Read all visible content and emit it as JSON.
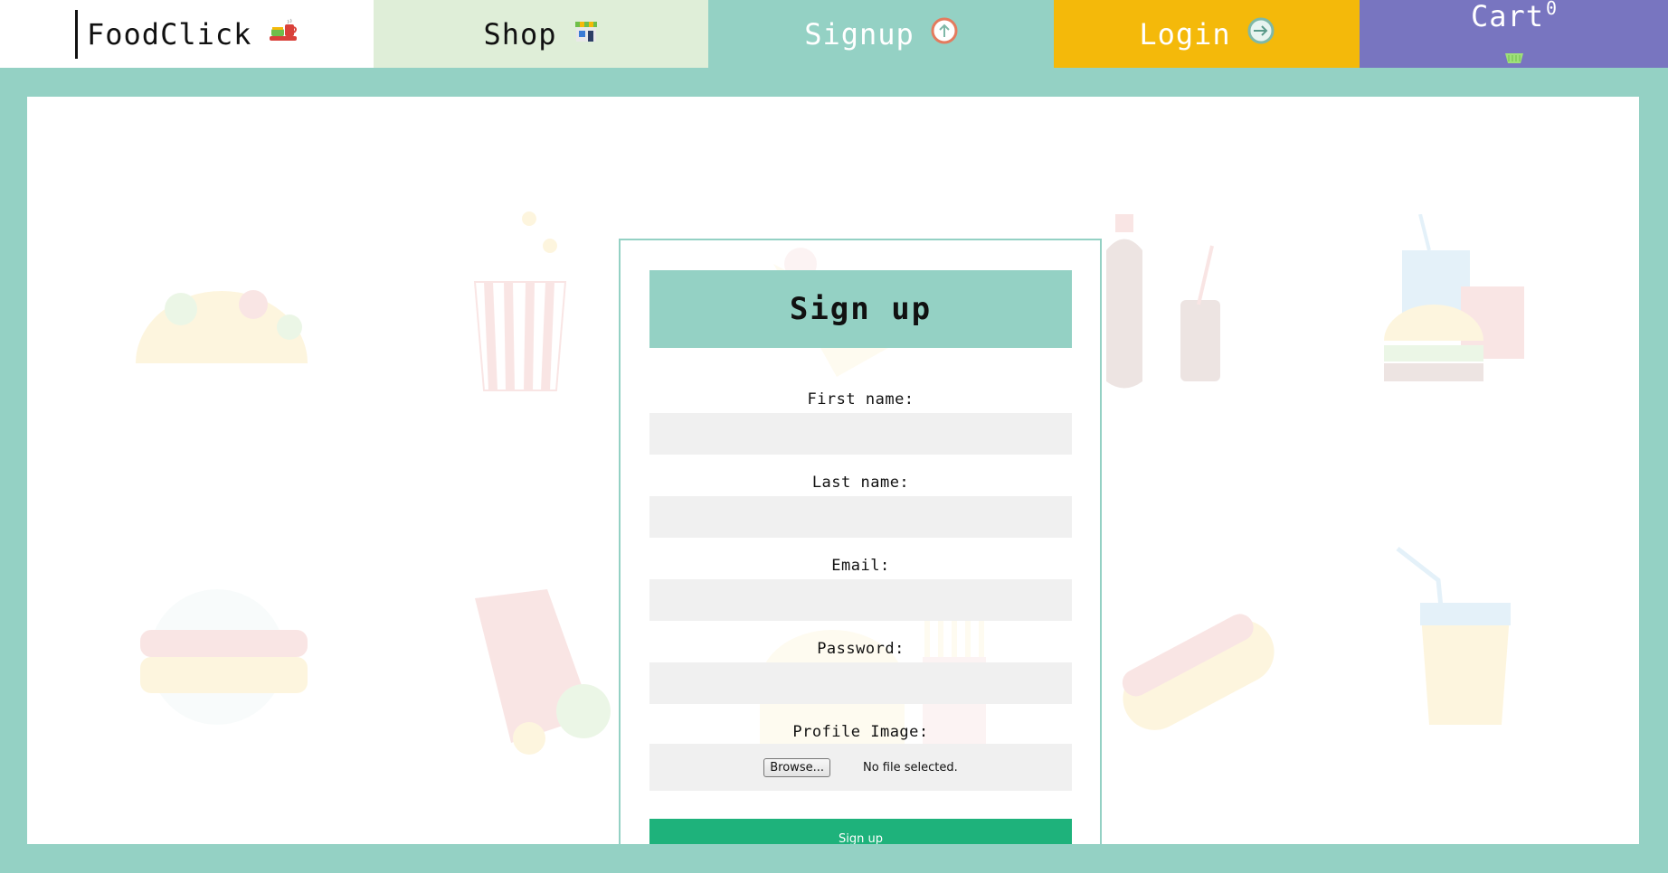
{
  "nav": {
    "brand": {
      "label": "FoodClick",
      "icon": "food-tray-icon"
    },
    "shop": {
      "label": "Shop",
      "icon": "storefront-icon",
      "bg": "#dfeed8"
    },
    "signup": {
      "label": "Signup",
      "icon": "upload-arrow-icon",
      "bg": "#94d1c4"
    },
    "login": {
      "label": "Login",
      "icon": "login-arrow-icon",
      "bg": "#f4b90a"
    },
    "cart": {
      "label": "Cart",
      "count": "0",
      "icon": "basket-icon",
      "bg": "#7875c0"
    }
  },
  "form": {
    "title": "Sign up",
    "fields": [
      {
        "label": "First name:",
        "value": ""
      },
      {
        "label": "Last name:",
        "value": ""
      },
      {
        "label": "Email:",
        "value": ""
      },
      {
        "label": "Password:",
        "value": ""
      }
    ],
    "profile_image": {
      "label": "Profile Image:",
      "browse_label": "Browse...",
      "status": "No file selected."
    },
    "submit_label": "Sign up"
  },
  "background_icons": [
    "taco-icon",
    "popcorn-icon",
    "pizza-slice-icon",
    "soda-bottle-icon",
    "burger-combo-icon",
    "sandwich-icon",
    "burrito-icon",
    "burger-fries-icon",
    "hotdog-icon",
    "juice-glass-icon"
  ],
  "colors": {
    "accent": "#94d1c4",
    "submit": "#1eb27b",
    "login": "#f4b90a",
    "cart": "#7875c0"
  }
}
